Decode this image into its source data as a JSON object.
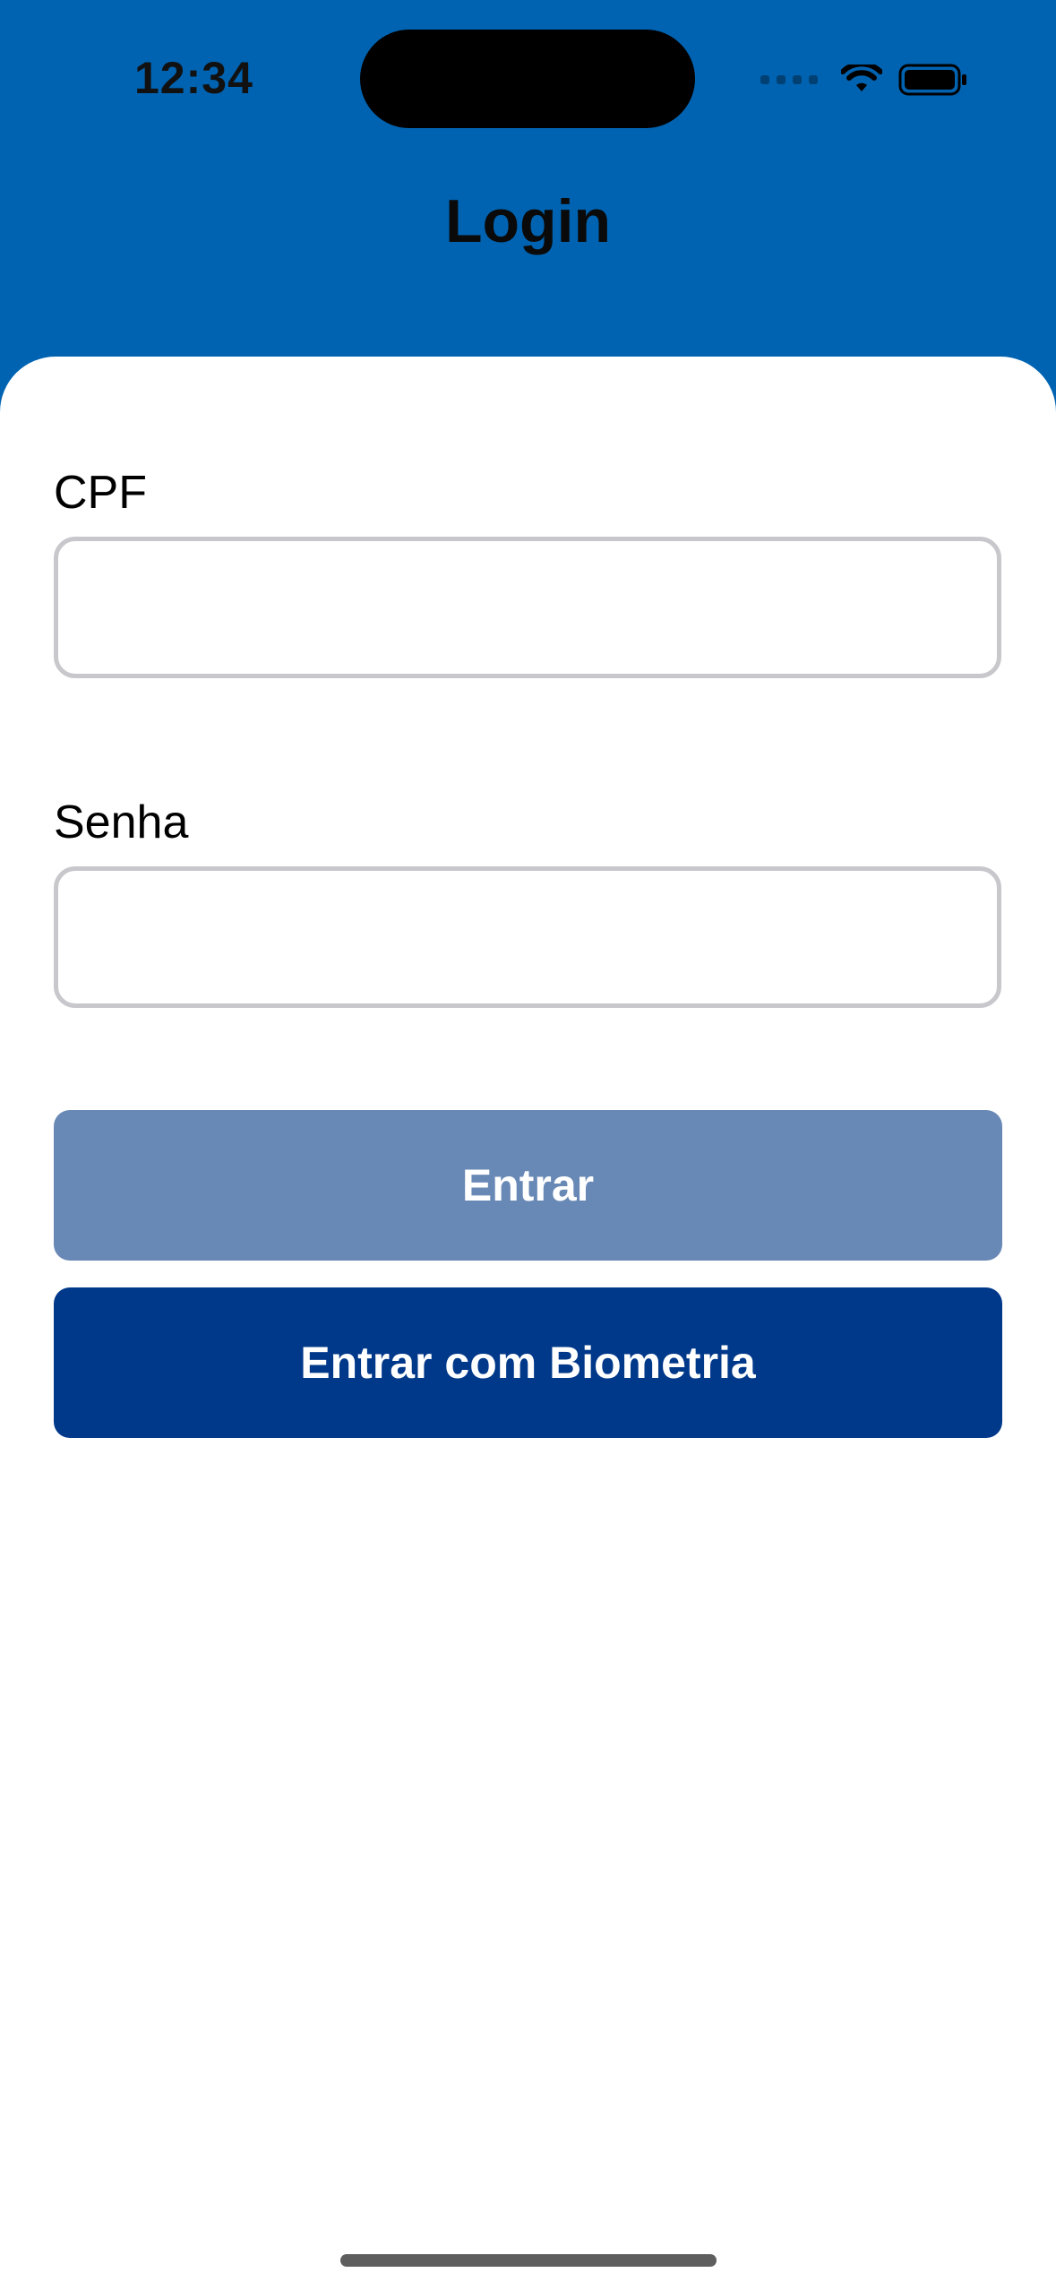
{
  "status_bar": {
    "time": "12:34",
    "icons": [
      "signal-icon",
      "wifi-icon",
      "battery-icon"
    ]
  },
  "header": {
    "title": "Login",
    "background_color": "#0063B1"
  },
  "form": {
    "cpf": {
      "label": "CPF",
      "value": "",
      "placeholder": ""
    },
    "senha": {
      "label": "Senha",
      "value": "",
      "placeholder": ""
    },
    "submit_button": {
      "label": "Entrar",
      "color": "#6888B6"
    },
    "biometric_button": {
      "label": "Entrar com Biometria",
      "color": "#00388A"
    }
  }
}
